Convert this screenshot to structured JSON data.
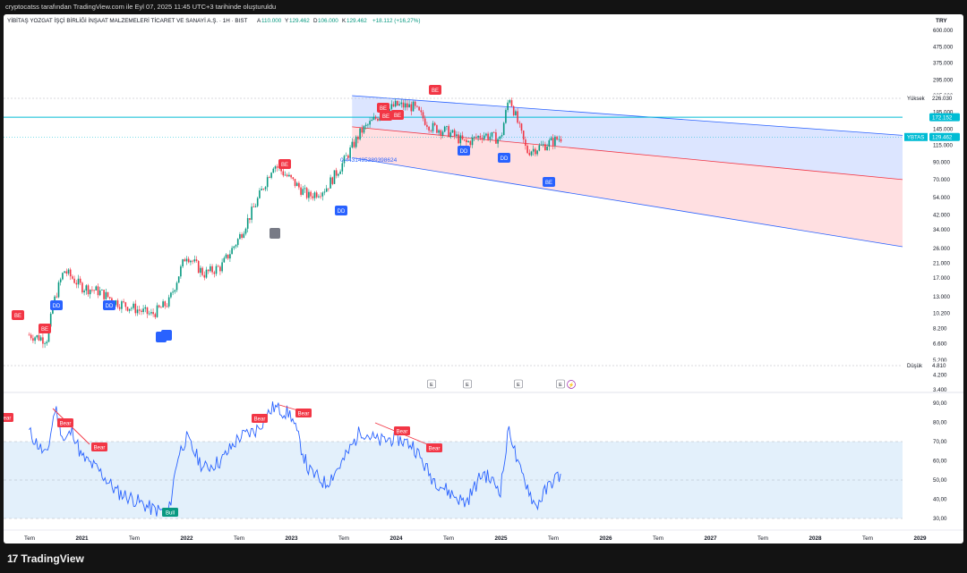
{
  "header_note": "cryptocatss tarafından TradingView.com ile Eyl 07, 2025 11:45 UTC+3 tarihinde oluşturuldu",
  "brand": {
    "logo": "17",
    "name": "TradingView"
  },
  "chart_data": [
    {
      "type": "candlestick",
      "title": "YİBİTAŞ YOZGAT İŞÇİ BİRLİĞİ İNŞAAT MALZEMELERİ TİCARET VE SANAYİ A.Ş. · 1H · BIST",
      "ohlc": {
        "open_label": "A",
        "open": "110.000",
        "high_label": "Y",
        "high": "129.462",
        "low_label": "D",
        "low": "106.000",
        "close_label": "K",
        "close": "129.462",
        "change": "+18.112 (+16,27%)"
      },
      "currency": "TRY",
      "y_scale": "log",
      "y_ticks": [
        "600.000",
        "475.000",
        "375.000",
        "295.000",
        "235.000",
        "185.000",
        "145.000",
        "115.000",
        "90.000",
        "70.000",
        "54.000",
        "42.000",
        "34.000",
        "26.000",
        "21.000",
        "17.000",
        "13.000",
        "10.200",
        "8.200",
        "6.600",
        "5.200",
        "4.200",
        "3.400"
      ],
      "price_labels": [
        {
          "name": "Yüksek",
          "value": "226.030"
        },
        {
          "name": "",
          "value": "172.152"
        },
        {
          "name": "YBTAS",
          "value": "129.462"
        },
        {
          "name": "Düşük",
          "value": "4.810"
        }
      ],
      "annotation": "0.4431495389398624",
      "signals": [
        "BE",
        "BE",
        "DD",
        "DD",
        "BE",
        "DD",
        "BE",
        "BE",
        "BE",
        "BE",
        "DD",
        "DD",
        "BE"
      ],
      "events": [
        "E",
        "E",
        "E",
        "E"
      ],
      "approx_closes": [
        {
          "t": "2020-07",
          "v": 7.5
        },
        {
          "t": "2020-09",
          "v": 7.0
        },
        {
          "t": "2020-10",
          "v": 13
        },
        {
          "t": "2020-11",
          "v": 19
        },
        {
          "t": "2021-01",
          "v": 15
        },
        {
          "t": "2021-03",
          "v": 14
        },
        {
          "t": "2021-05",
          "v": 12
        },
        {
          "t": "2021-07",
          "v": 11
        },
        {
          "t": "2021-09",
          "v": 10
        },
        {
          "t": "2021-11",
          "v": 12
        },
        {
          "t": "2022-01",
          "v": 24
        },
        {
          "t": "2022-03",
          "v": 18
        },
        {
          "t": "2022-05",
          "v": 20
        },
        {
          "t": "2022-07",
          "v": 30
        },
        {
          "t": "2022-09",
          "v": 50
        },
        {
          "t": "2022-11",
          "v": 88
        },
        {
          "t": "2023-01",
          "v": 70
        },
        {
          "t": "2023-03",
          "v": 55
        },
        {
          "t": "2023-05",
          "v": 62
        },
        {
          "t": "2023-07",
          "v": 90
        },
        {
          "t": "2023-09",
          "v": 140
        },
        {
          "t": "2023-11",
          "v": 175
        },
        {
          "t": "2024-01",
          "v": 205
        },
        {
          "t": "2024-03",
          "v": 200
        },
        {
          "t": "2024-05",
          "v": 150
        },
        {
          "t": "2024-07",
          "v": 140
        },
        {
          "t": "2024-09",
          "v": 118
        },
        {
          "t": "2024-11",
          "v": 135
        },
        {
          "t": "2025-01",
          "v": 125
        },
        {
          "t": "2025-02",
          "v": 235
        },
        {
          "t": "2025-04",
          "v": 105
        },
        {
          "t": "2025-06",
          "v": 115
        },
        {
          "t": "2025-08",
          "v": 129.462
        }
      ],
      "channel": {
        "upper": [
          {
            "t": "2023-08",
            "v": 235
          },
          {
            "t": "2029-12",
            "v": 118
          }
        ],
        "middle": [
          {
            "t": "2023-08",
            "v": 150
          },
          {
            "t": "2029-12",
            "v": 60
          }
        ],
        "lower": [
          {
            "t": "2023-08",
            "v": 96
          },
          {
            "t": "2029-12",
            "v": 20.5
          }
        ]
      },
      "horizontal_line": 172.152
    },
    {
      "type": "line",
      "series_name": "RSI",
      "y_ticks": [
        "90,00",
        "80,00",
        "70,00",
        "60,00",
        "50,00",
        "40,00",
        "30,00"
      ],
      "band": [
        30,
        70
      ],
      "mid_line": 50,
      "labels": [
        "Bear",
        "Bear",
        "Bear",
        "Bull",
        "Bear",
        "Bear",
        "Bear",
        "Bear"
      ],
      "approx_values": [
        {
          "t": "2020-07",
          "v": 75
        },
        {
          "t": "2020-09",
          "v": 62
        },
        {
          "t": "2020-10",
          "v": 88
        },
        {
          "t": "2020-11",
          "v": 70
        },
        {
          "t": "2020-12",
          "v": 76
        },
        {
          "t": "2021-01",
          "v": 62
        },
        {
          "t": "2021-03",
          "v": 55
        },
        {
          "t": "2021-05",
          "v": 44
        },
        {
          "t": "2021-07",
          "v": 40
        },
        {
          "t": "2021-09",
          "v": 35
        },
        {
          "t": "2021-11",
          "v": 33
        },
        {
          "t": "2021-12",
          "v": 62
        },
        {
          "t": "2022-01",
          "v": 72
        },
        {
          "t": "2022-03",
          "v": 56
        },
        {
          "t": "2022-05",
          "v": 60
        },
        {
          "t": "2022-07",
          "v": 72
        },
        {
          "t": "2022-09",
          "v": 76
        },
        {
          "t": "2022-11",
          "v": 88
        },
        {
          "t": "2023-01",
          "v": 84
        },
        {
          "t": "2023-03",
          "v": 55
        },
        {
          "t": "2023-05",
          "v": 48
        },
        {
          "t": "2023-07",
          "v": 60
        },
        {
          "t": "2023-09",
          "v": 76
        },
        {
          "t": "2023-11",
          "v": 70
        },
        {
          "t": "2024-01",
          "v": 72
        },
        {
          "t": "2024-03",
          "v": 68
        },
        {
          "t": "2024-05",
          "v": 52
        },
        {
          "t": "2024-07",
          "v": 44
        },
        {
          "t": "2024-09",
          "v": 38
        },
        {
          "t": "2024-11",
          "v": 54
        },
        {
          "t": "2025-01",
          "v": 45
        },
        {
          "t": "2025-02",
          "v": 78
        },
        {
          "t": "2025-03",
          "v": 57
        },
        {
          "t": "2025-04",
          "v": 48
        },
        {
          "t": "2025-05",
          "v": 36
        },
        {
          "t": "2025-07",
          "v": 50
        },
        {
          "t": "2025-08",
          "v": 53
        }
      ]
    }
  ],
  "x_axis": {
    "labels": [
      "Tem",
      "2021",
      "Tem",
      "2022",
      "Tem",
      "2023",
      "Tem",
      "2024",
      "Tem",
      "2025",
      "Tem",
      "2026",
      "Tem",
      "2027",
      "Tem",
      "2028",
      "Tem",
      "2029"
    ]
  },
  "colors": {
    "up": "#089981",
    "down": "#f23645",
    "rsi": "#2962ff",
    "channel_upper": "#d6e0ff",
    "channel_lower": "#ffd9dc",
    "cyan": "#00bcd4",
    "label_red": "#f23645",
    "label_blue": "#2962ff"
  }
}
